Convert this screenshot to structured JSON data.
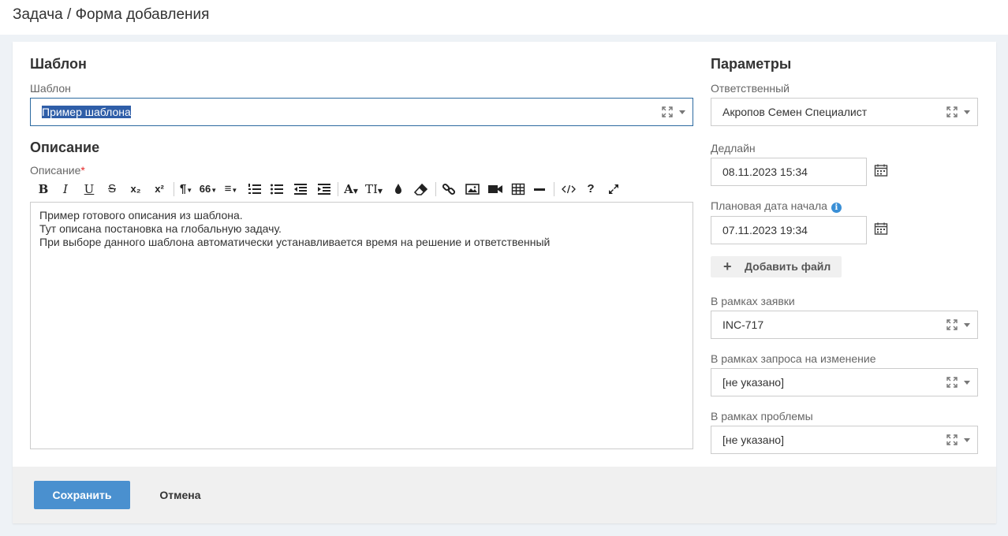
{
  "page": {
    "title": "Задача / Форма добавления"
  },
  "left": {
    "template_section_title": "Шаблон",
    "template_label": "Шаблон",
    "template_value": "Пример шаблона",
    "description_section_title": "Описание",
    "description_label": "Описание",
    "required_mark": "*",
    "description_lines": [
      "Пример готового описания из шаблона.",
      "Тут описана постановка на глобальную задачу.",
      "При выборе данного шаблона автоматически устанавливается время на решение и ответственный"
    ]
  },
  "toolbar": {
    "bold": "B",
    "italic": "I",
    "underline": "U",
    "strike": "S",
    "subscript": "x₂",
    "superscript": "x²",
    "paragraph": "¶",
    "quote": "66",
    "align": "≡",
    "text_color": "A",
    "font_size": "TI",
    "help": "?",
    "icons": [
      "bold-icon",
      "italic-icon",
      "underline-icon",
      "strikethrough-icon",
      "subscript-icon",
      "superscript-icon",
      "paragraph-icon",
      "quote-icon",
      "align-icon",
      "ordered-list-icon",
      "unordered-list-icon",
      "outdent-icon",
      "indent-icon",
      "text-color-icon",
      "font-size-icon",
      "background-color-icon",
      "clear-format-icon",
      "link-icon",
      "image-icon",
      "video-icon",
      "table-icon",
      "horizontal-line-icon",
      "code-view-icon",
      "help-icon",
      "fullscreen-icon"
    ]
  },
  "right": {
    "params_title": "Параметры",
    "responsible_label": "Ответственный",
    "responsible_value": "Акропов Семен Специалист",
    "deadline_label": "Дедлайн",
    "deadline_value": "08.11.2023 15:34",
    "start_label": "Плановая дата начала",
    "start_value": "07.11.2023 19:34",
    "info_icon": "i",
    "add_file_plus": "+",
    "add_file_label": "Добавить файл",
    "request_label": "В рамках заявки",
    "request_value": "INC-717",
    "change_label": "В рамках запроса на изменение",
    "change_value": "[не указано]",
    "problem_label": "В рамках проблемы",
    "problem_value": "[не указано]"
  },
  "footer": {
    "save_label": "Сохранить",
    "cancel_label": "Отмена"
  },
  "colors": {
    "primary": "#4a90cf",
    "selection": "#2f5ea8",
    "required": "#e52929",
    "info": "#3a8fd6"
  }
}
